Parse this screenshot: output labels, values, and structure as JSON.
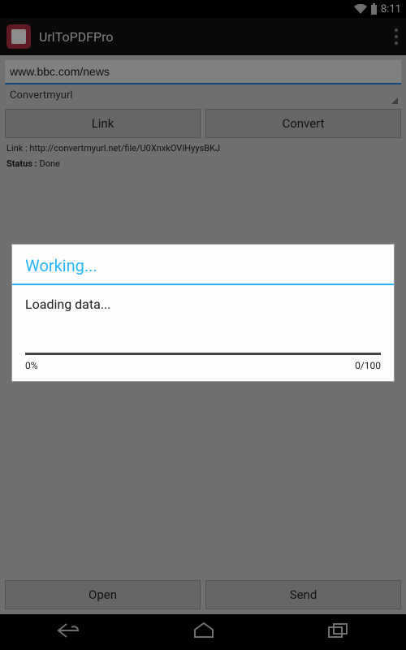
{
  "statusbar": {
    "time": "8:11"
  },
  "appbar": {
    "title": "UrlToPDFPro"
  },
  "main": {
    "url_value": "www.bbc.com/news",
    "spinner_label": "Convertmyurl",
    "link_button": "Link",
    "convert_button": "Convert",
    "link_prefix": "Link : ",
    "link_url": "http://convertmyurl.net/file/U0XnxkOVIHyysBKJ",
    "status_prefix": "Status : ",
    "status_value": "Done",
    "open_button": "Open",
    "send_button": "Send"
  },
  "dialog": {
    "title": "Working...",
    "message": "Loading data...",
    "percent": "0%",
    "count": "0/100"
  }
}
